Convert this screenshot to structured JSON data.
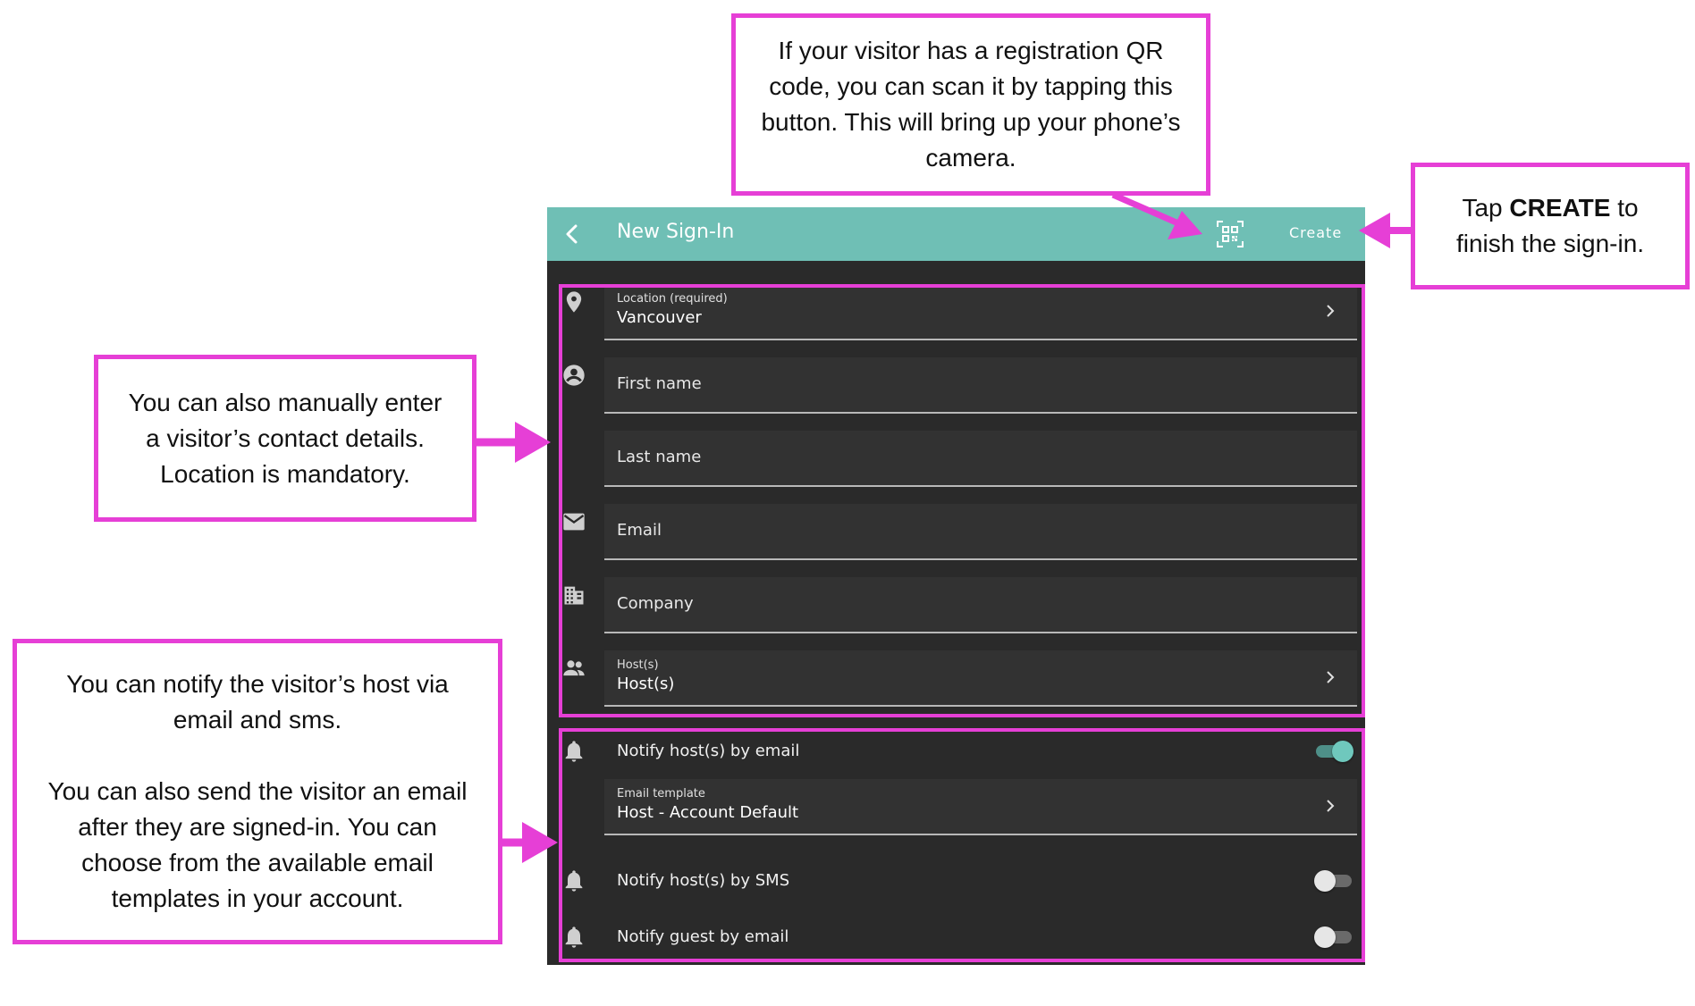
{
  "callouts": {
    "qr": "If your visitor has a registration QR code, you can scan it by tapping this button. This will bring up your phone’s camera.",
    "create_pre": "Tap ",
    "create_bold": "CREATE",
    "create_post": " to finish the sign-in.",
    "contact": "You can also manually enter a visitor’s contact details. Location is mandatory.",
    "notify_p1": "You can notify the visitor’s host via email and sms.",
    "notify_p2": "You can also send the visitor an email after they are signed-in. You can choose from the available email templates in your account."
  },
  "appbar": {
    "title": "New Sign-In",
    "create_label": "Create",
    "color": "#6fbfb5"
  },
  "form": {
    "location": {
      "label": "Location (required)",
      "value": "Vancouver",
      "icon": "location-pin-icon"
    },
    "first_name": {
      "placeholder": "First name",
      "icon": "account-circle-icon"
    },
    "last_name": {
      "placeholder": "Last name"
    },
    "email": {
      "placeholder": "Email",
      "icon": "mail-icon"
    },
    "company": {
      "placeholder": "Company",
      "icon": "building-icon"
    },
    "hosts": {
      "label": "Host(s)",
      "value": "Host(s)",
      "icon": "people-icon"
    }
  },
  "notifications": {
    "notify_host_email": {
      "label": "Notify host(s) by email",
      "on": true
    },
    "email_template": {
      "label": "Email template",
      "value": "Host - Account Default"
    },
    "notify_host_sms": {
      "label": "Notify host(s) by SMS",
      "on": false
    },
    "notify_guest_email": {
      "label": "Notify guest by email",
      "on": false
    }
  },
  "colors": {
    "highlight": "#e63fd6",
    "background": "#2a2a2a",
    "accent": "#6fc8bd"
  }
}
